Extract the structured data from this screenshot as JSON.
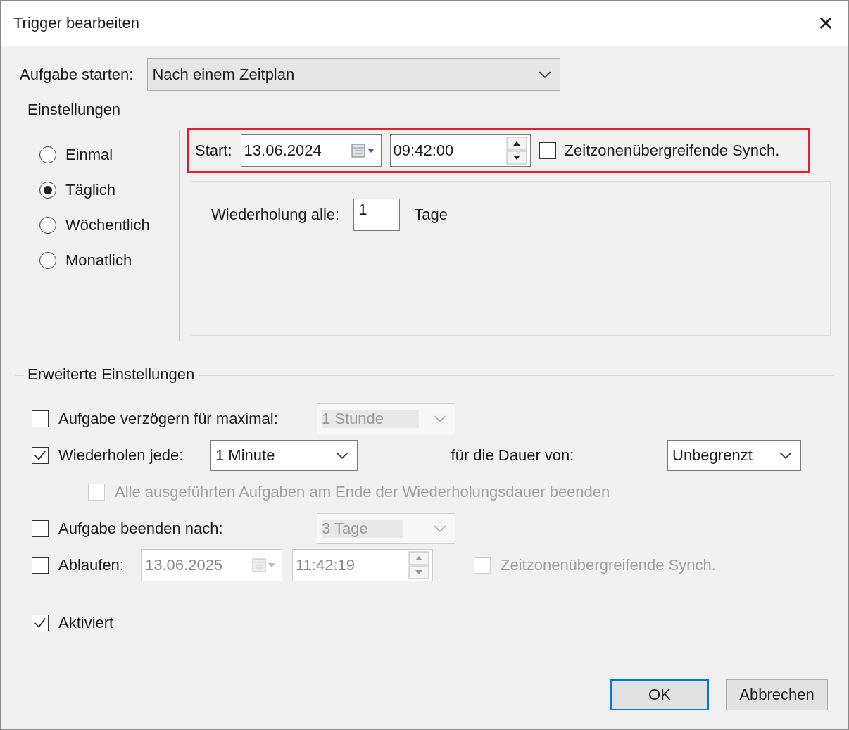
{
  "window": {
    "title": "Trigger bearbeiten",
    "close": "✕"
  },
  "start_task": {
    "label": "Aufgabe starten:",
    "value": "Nach einem Zeitplan"
  },
  "settings": {
    "legend": "Einstellungen",
    "schedule_options": [
      {
        "label": "Einmal",
        "selected": false
      },
      {
        "label": "Täglich",
        "selected": true
      },
      {
        "label": "Wöchentlich",
        "selected": false
      },
      {
        "label": "Monatlich",
        "selected": false
      }
    ],
    "start": {
      "highlighted": true,
      "label": "Start:",
      "date": "13.06.2024",
      "time": "09:42:00",
      "sync": {
        "label": "Zeitzonenübergreifende Synch.",
        "checked": false
      }
    },
    "recurrence": {
      "label": "Wiederholung alle:",
      "value": "1",
      "unit": "Tage"
    }
  },
  "advanced": {
    "legend": "Erweiterte Einstellungen",
    "delay": {
      "label": "Aufgabe verzögern für maximal:",
      "checked": false,
      "dropdown": {
        "value": "1 Stunde",
        "disabled": true
      }
    },
    "repeat": {
      "label": "Wiederholen jede:",
      "checked": true,
      "dropdown": {
        "value": "1 Minute",
        "disabled": false
      },
      "duration": {
        "label": "für die Dauer von:",
        "dropdown": {
          "value": "Unbegrenzt",
          "disabled": false
        }
      },
      "stop_all": {
        "label": "Alle ausgeführten Aufgaben am Ende der Wiederholungsdauer beenden",
        "checked": false,
        "disabled": true
      }
    },
    "end_after": {
      "label": "Aufgabe beenden nach:",
      "checked": false,
      "dropdown": {
        "value": "3 Tage",
        "disabled": true
      }
    },
    "expire": {
      "label": "Ablaufen:",
      "checked": false,
      "disabled": true,
      "date": "13.06.2025",
      "time": "11:42:19",
      "sync": {
        "label": "Zeitzonenübergreifende Synch.",
        "checked": false,
        "disabled": true
      }
    },
    "enabled": {
      "label": "Aktiviert",
      "checked": true
    }
  },
  "buttons": [
    {
      "label": "OK",
      "default": true
    },
    {
      "label": "Abbrechen",
      "default": false
    }
  ]
}
